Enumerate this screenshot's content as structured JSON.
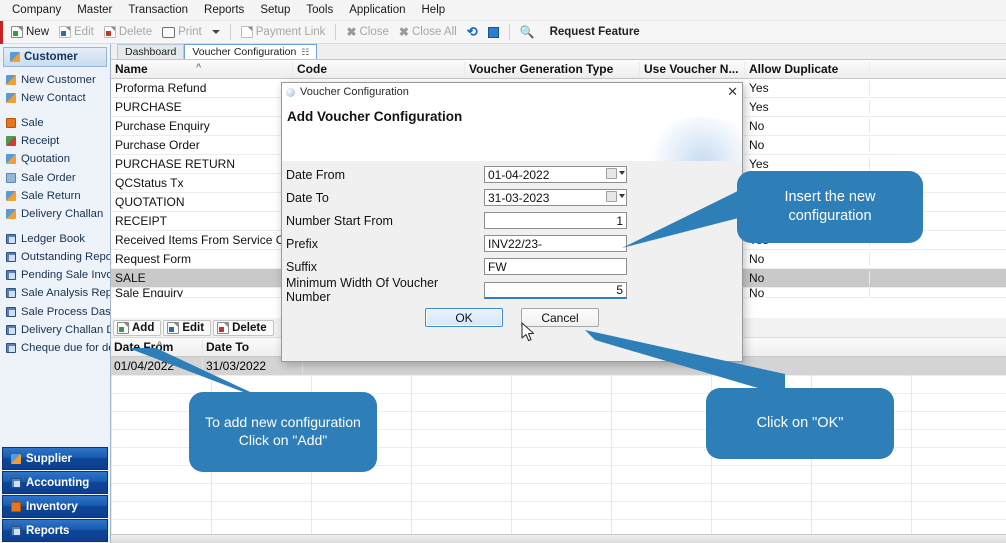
{
  "menubar": {
    "items": [
      "Company",
      "Master",
      "Transaction",
      "Reports",
      "Setup",
      "Tools",
      "Application",
      "Help"
    ]
  },
  "toolbar": {
    "new": "New",
    "edit": "Edit",
    "delete": "Delete",
    "print": "Print",
    "payment_link": "Payment Link",
    "close": "Close",
    "close_all": "Close All",
    "request_feature": "Request Feature"
  },
  "sidebar": {
    "header": "Customer",
    "group1": [
      "New Customer",
      "New Contact"
    ],
    "group2": [
      "Sale",
      "Receipt",
      "Quotation",
      "Sale Order",
      "Sale Return",
      "Delivery Challan"
    ],
    "group3": [
      "Ledger Book",
      "Outstanding Report",
      "Pending Sale Invoices",
      "Sale Analysis Report",
      "Sale Process Dashboa",
      "Delivery Challan Dashl",
      "Cheque due for depos"
    ],
    "bottom": [
      "Supplier",
      "Accounting",
      "Inventory",
      "Reports"
    ]
  },
  "tabs": [
    {
      "label": "Dashboard",
      "closable": false,
      "active": false
    },
    {
      "label": "Voucher Configuration",
      "closable": true,
      "active": true
    }
  ],
  "grid": {
    "columns": [
      "Name",
      "Code",
      "Voucher Generation Type",
      "Use Voucher N...",
      "Allow Duplicate"
    ],
    "rows": [
      {
        "name": "Proforma Refund",
        "dup": "Yes",
        "selected": false
      },
      {
        "name": "PURCHASE",
        "dup": "Yes",
        "selected": false
      },
      {
        "name": "Purchase Enquiry",
        "dup": "No",
        "selected": false
      },
      {
        "name": "Purchase Order",
        "dup": "No",
        "selected": false
      },
      {
        "name": "PURCHASE RETURN",
        "dup": "Yes",
        "selected": false
      },
      {
        "name": "QCStatus Tx",
        "dup": "",
        "selected": false
      },
      {
        "name": "QUOTATION",
        "dup": "",
        "selected": false
      },
      {
        "name": "RECEIPT",
        "dup": "",
        "selected": false
      },
      {
        "name": "Received Items From Service C..",
        "dup": "Yes",
        "selected": false
      },
      {
        "name": "Request Form",
        "dup": "No",
        "selected": false
      },
      {
        "name": "SALE",
        "dup": "No",
        "selected": true
      },
      {
        "name": "Sale Enquiry",
        "dup": "No",
        "selected": false
      }
    ]
  },
  "detail": {
    "buttons": [
      "Add",
      "Edit",
      "Delete"
    ],
    "columns": [
      "Date From",
      "Date To"
    ],
    "rows": [
      {
        "date_from": "01/04/2022",
        "date_to": "31/03/2022"
      }
    ]
  },
  "dialog": {
    "window_title": "Voucher Configuration",
    "heading": "Add Voucher Configuration",
    "close_label": "✕",
    "fields": [
      {
        "label": "Date From",
        "value": "01-04-2022",
        "type": "date"
      },
      {
        "label": "Date To",
        "value": "31-03-2023",
        "type": "date"
      },
      {
        "label": "Number Start From",
        "value": "1",
        "type": "number"
      },
      {
        "label": "Prefix",
        "value": "INV22/23-",
        "type": "text"
      },
      {
        "label": "Suffix",
        "value": "FW",
        "type": "text"
      },
      {
        "label": "Minimum Width Of Voucher Number",
        "value": "5",
        "type": "number"
      }
    ],
    "ok": "OK",
    "cancel": "Cancel"
  },
  "callouts": [
    {
      "id": "insert-config",
      "text": "Insert the new configuration"
    },
    {
      "id": "add-config",
      "text": "To add new configuration Click on \"Add\""
    },
    {
      "id": "click-ok",
      "text": "Click on \"OK\""
    }
  ],
  "colors": {
    "callout_blue": "#2e7eb8",
    "sidebar_blue": "#0f4697",
    "accent_focus": "#2f7fc4",
    "selection_gray": "#c9c9c9"
  }
}
